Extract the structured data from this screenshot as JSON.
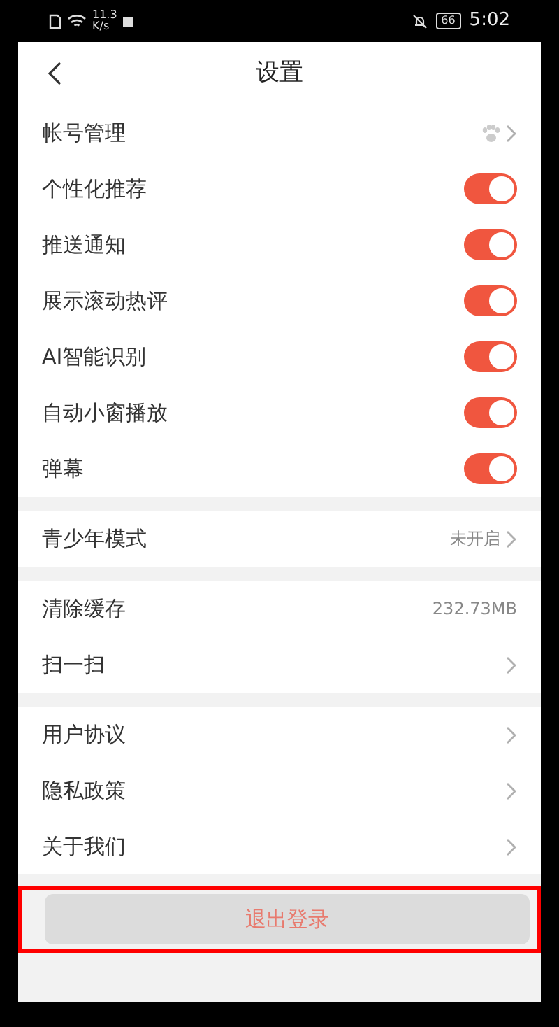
{
  "status_bar": {
    "speed": "11.3",
    "speed_unit": "K/s",
    "battery": "66",
    "time": "5:02"
  },
  "header": {
    "title": "设置"
  },
  "sections": [
    {
      "rows": [
        {
          "kind": "account",
          "label": "帐号管理"
        },
        {
          "kind": "toggle",
          "label": "个性化推荐",
          "on": true
        },
        {
          "kind": "toggle",
          "label": "推送通知",
          "on": true
        },
        {
          "kind": "toggle",
          "label": "展示滚动热评",
          "on": true
        },
        {
          "kind": "toggle",
          "label": "AI智能识别",
          "on": true
        },
        {
          "kind": "toggle",
          "label": "自动小窗播放",
          "on": true
        },
        {
          "kind": "toggle",
          "label": "弹幕",
          "on": true
        }
      ]
    },
    {
      "rows": [
        {
          "kind": "link",
          "label": "青少年模式",
          "value": "未开启"
        }
      ]
    },
    {
      "rows": [
        {
          "kind": "value",
          "label": "清除缓存",
          "value": "232.73MB"
        },
        {
          "kind": "link",
          "label": "扫一扫"
        }
      ]
    },
    {
      "rows": [
        {
          "kind": "link",
          "label": "用户协议"
        },
        {
          "kind": "link",
          "label": "隐私政策"
        },
        {
          "kind": "link",
          "label": "关于我们"
        }
      ]
    }
  ],
  "logout_button": {
    "label": "退出登录",
    "highlighted": true
  }
}
